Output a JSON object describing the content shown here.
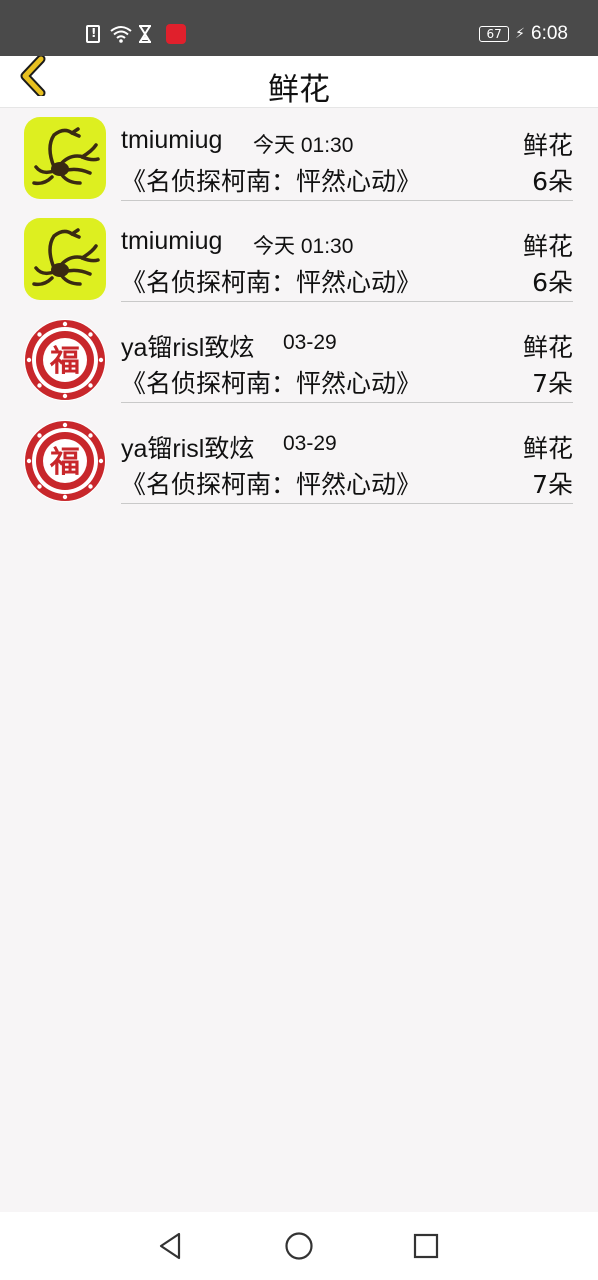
{
  "status_bar": {
    "battery": "67",
    "time": "6:08",
    "icons": [
      "sim-alert-icon",
      "wifi-icon",
      "hourglass-icon",
      "app-badge-icon",
      "charging-bolt-icon"
    ]
  },
  "header": {
    "title": "鲜花",
    "back_icon": "chevron-left-icon"
  },
  "records": [
    {
      "avatar": "scorpion-avatar",
      "username": "tmiumiug",
      "time": "今天 01:30",
      "gift": "鲜花",
      "work": "《名侦探柯南：怦然心动》",
      "count": "6朵"
    },
    {
      "avatar": "scorpion-avatar",
      "username": "tmiumiug",
      "time": "今天 01:30",
      "gift": "鲜花",
      "work": "《名侦探柯南：怦然心动》",
      "count": "6朵"
    },
    {
      "avatar": "fu-avatar",
      "username": "ya镏risl致炫",
      "time": "03-29",
      "gift": "鲜花",
      "work": "《名侦探柯南：怦然心动》",
      "count": "7朵"
    },
    {
      "avatar": "fu-avatar",
      "username": "ya镏risl致炫",
      "time": "03-29",
      "gift": "鲜花",
      "work": "《名侦探柯南：怦然心动》",
      "count": "7朵"
    }
  ],
  "nav": {
    "buttons": [
      "back-triangle-icon",
      "home-circle-icon",
      "recents-square-icon"
    ]
  },
  "colors": {
    "status_bar_bg": "#4a4a4a",
    "page_bg": "#f7f5f6",
    "back_arrow": "#e8c020",
    "fu_red": "#c8272b",
    "scorpion_bg": "#ddef20"
  }
}
